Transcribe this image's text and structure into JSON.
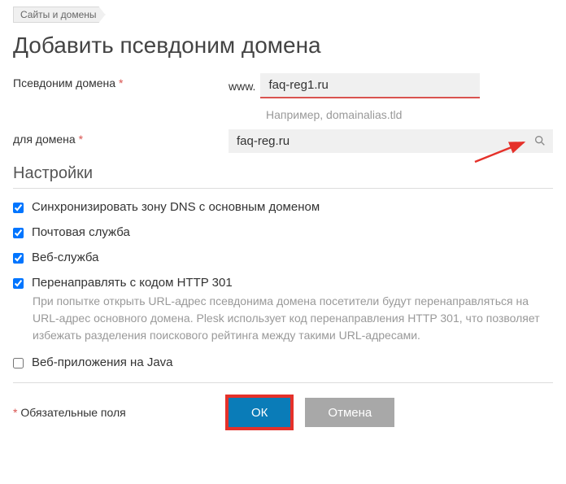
{
  "breadcrumb": "Сайты и домены",
  "page_title": "Добавить псевдоним домена",
  "alias_label": "Псевдоним домена",
  "www_prefix": "www.",
  "alias_value": "faq-reg1.ru",
  "alias_hint": "Например, domainalias.tld",
  "for_domain_label": "для домена",
  "for_domain_value": "faq-reg.ru",
  "settings_title": "Настройки",
  "checkboxes": {
    "dns_sync": {
      "label": "Синхронизировать зону DNS с основным доменом",
      "checked": true
    },
    "mail": {
      "label": "Почтовая служба",
      "checked": true
    },
    "web": {
      "label": "Веб-служба",
      "checked": true
    },
    "redirect": {
      "label": "Перенаправлять с кодом HTTP 301",
      "checked": true,
      "desc": "При попытке открыть URL-адрес псевдонима домена посетители будут перенаправляться на URL-адрес основного домена. Plesk использует код перенаправления HTTP 301, что позволяет избежать разделения поискового рейтинга между такими URL-адресами."
    },
    "java": {
      "label": "Веб-приложения на Java",
      "checked": false
    }
  },
  "required_note": "Обязательные поля",
  "buttons": {
    "ok": "ОК",
    "cancel": "Отмена"
  }
}
